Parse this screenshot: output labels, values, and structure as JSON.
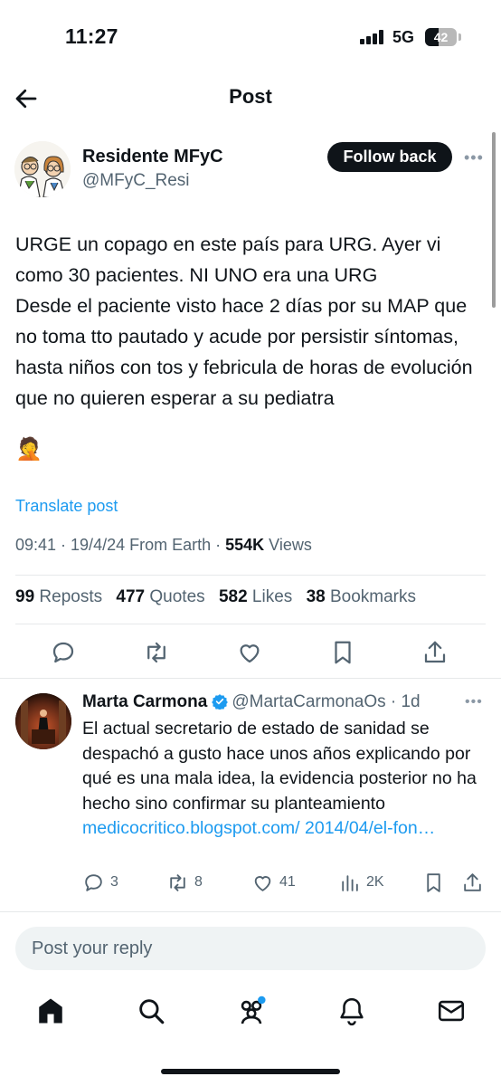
{
  "status_bar": {
    "time": "11:27",
    "network": "5G",
    "battery_level": "42"
  },
  "header": {
    "title": "Post",
    "back_icon": "arrow-left-icon"
  },
  "author": {
    "name": "Residente MFyC",
    "handle": "@MFyC_Resi",
    "follow_label": "Follow back",
    "more_label": "•••"
  },
  "post": {
    "text": "URGE un copago en este país para URG. Ayer vi como 30 pacientes. NI UNO era una URG\nDesde el paciente visto hace 2 días por su MAP que no toma tto pautado y acude por persistir síntomas, hasta niños con tos y febricula de horas de evolución que no quieren esperar a su pediatra",
    "emoji": "🤦",
    "translate_label": "Translate post",
    "meta_text": "09:41 · 19/4/24 From Earth · ",
    "views_count": "554K",
    "views_label": " Views"
  },
  "stats": [
    {
      "count": "99",
      "label": " Reposts"
    },
    {
      "count": "477",
      "label": " Quotes"
    },
    {
      "count": "582",
      "label": " Likes"
    },
    {
      "count": "38",
      "label": " Bookmarks"
    }
  ],
  "actions": [
    "reply-icon",
    "repost-icon",
    "like-icon",
    "bookmark-icon",
    "share-icon"
  ],
  "reply": {
    "name": "Marta Carmona",
    "handle": "@MartaCarmonaOs",
    "time": " · 1d",
    "more_label": "•••",
    "text": "El actual secretario de estado de sanidad se despachó a gusto hace unos años explicando por qué es una mala idea, la evidencia posterior no ha hecho sino confirmar su planteamiento ",
    "link": "medicocritico.blogspot.com/ 2014/04/el-fon…",
    "counts": {
      "replies": "3",
      "reposts": "8",
      "likes": "41",
      "views": "2K"
    }
  },
  "composer": {
    "placeholder": "Post your reply"
  },
  "tabbar": [
    "home-icon",
    "search-icon",
    "communities-icon",
    "notifications-icon",
    "messages-icon"
  ],
  "colors": {
    "accent": "#1d9bf0",
    "text": "#0f1419",
    "secondary": "#536471",
    "verified": "#1d9bf0"
  }
}
